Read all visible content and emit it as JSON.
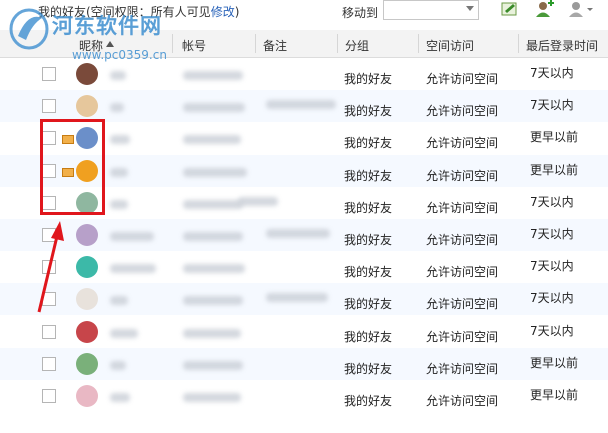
{
  "topbar": {
    "group_title": "我的好友(空间权限：所有人可见",
    "edit_link": "修改",
    "close_paren": ")",
    "move_to_label": "移动到",
    "move_to_value": ""
  },
  "watermark": {
    "text": "河东软件网",
    "url": "www.pc0359.cn"
  },
  "columns": {
    "nickname": "昵称",
    "account": "帐号",
    "note": "备注",
    "group": "分组",
    "space_access": "空间访问",
    "last_login": "最后登录时间"
  },
  "rows": [
    {
      "group": "我的好友",
      "access": "允许访问空间",
      "login": "7天以内",
      "mail": false,
      "avatar_color": "#7a4a3a"
    },
    {
      "group": "我的好友",
      "access": "允许访问空间",
      "login": "7天以内",
      "mail": false,
      "avatar_color": "#e6c79c"
    },
    {
      "group": "我的好友",
      "access": "允许访问空间",
      "login": "更早以前",
      "mail": true,
      "avatar_color": "#6b8fc9"
    },
    {
      "group": "我的好友",
      "access": "允许访问空间",
      "login": "更早以前",
      "mail": true,
      "avatar_color": "#f0a020"
    },
    {
      "group": "我的好友",
      "access": "允许访问空间",
      "login": "7天以内",
      "mail": false,
      "avatar_color": "#8fb7a0"
    },
    {
      "group": "我的好友",
      "access": "允许访问空间",
      "login": "7天以内",
      "mail": false,
      "avatar_color": "#b7a0c9"
    },
    {
      "group": "我的好友",
      "access": "允许访问空间",
      "login": "7天以内",
      "mail": false,
      "avatar_color": "#3cb9a8"
    },
    {
      "group": "我的好友",
      "access": "允许访问空间",
      "login": "7天以内",
      "mail": false,
      "avatar_color": "#e8e2dc"
    },
    {
      "group": "我的好友",
      "access": "允许访问空间",
      "login": "7天以内",
      "mail": false,
      "avatar_color": "#c7454a"
    },
    {
      "group": "我的好友",
      "access": "允许访问空间",
      "login": "更早以前",
      "mail": false,
      "avatar_color": "#7ab07a"
    },
    {
      "group": "我的好友",
      "access": "允许访问空间",
      "login": "更早以前",
      "mail": false,
      "avatar_color": "#e9b8c4"
    }
  ]
}
